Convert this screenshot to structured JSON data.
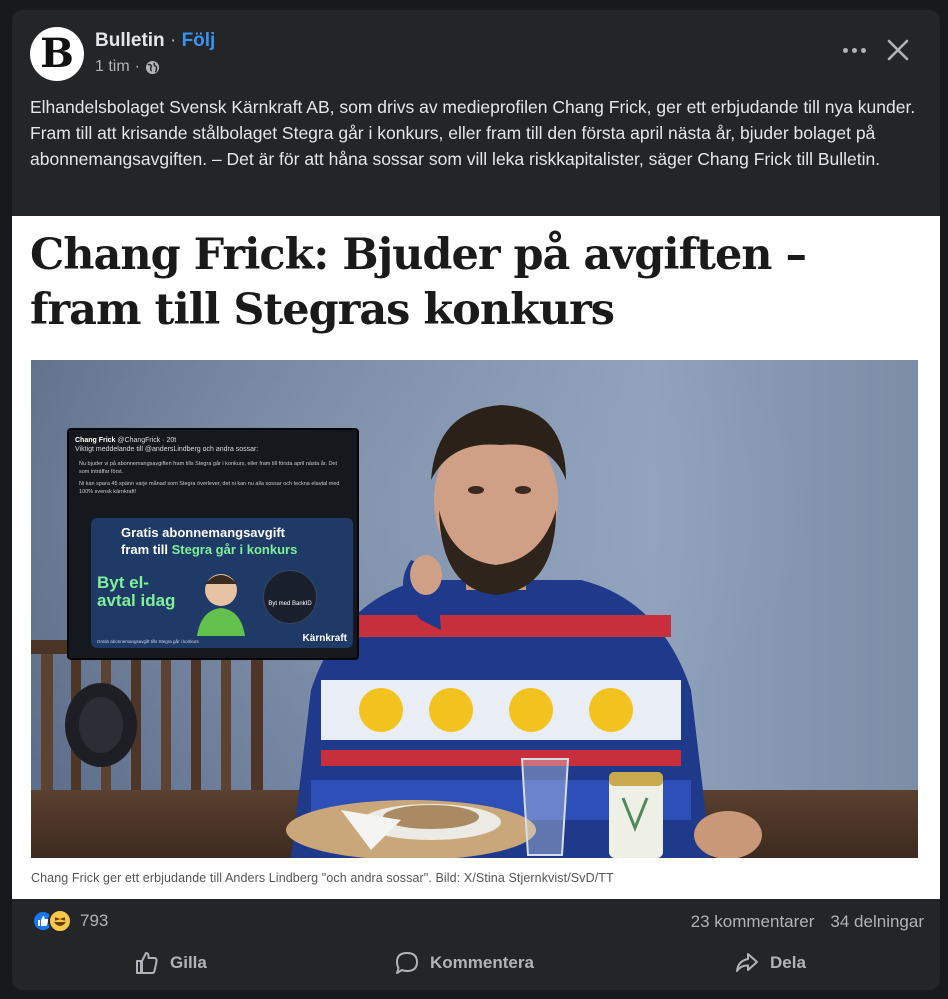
{
  "post": {
    "author": "Bulletin",
    "separator": "·",
    "follow_label": "Följ",
    "time": "1 tim",
    "time_separator": "·",
    "avatar_letter": "B",
    "text": "Elhandelsbolaget Svensk Kärnkraft AB, som drivs av medieprofilen Chang Frick, ger ett erbjudande till nya kunder. Fram till att krisande stålbolaget Stegra går i konkurs, eller fram till den första april nästa år, bjuder bolaget på abonnemangsavgiften. – Det är för att håna sossar som vill leka riskkapitalister, säger Chang Frick till Bulletin."
  },
  "article": {
    "headline": "Chang Frick: Bjuder på avgiften – fram till Stegras konkurs",
    "caption": "Chang Frick ger ett erbjudande till Anders Lindberg \"och andra sossar\". Bild: X/Stina Stjernkvist/SvD/TT"
  },
  "screen": {
    "name": "Chang Frick",
    "handle": "@ChangFrick · 20t",
    "line1": "Viktigt meddelande till @andersLindberg och andra sossar:",
    "line2": "Nu bjuder vi på abonnemangsavgiften fram tills Stegra går i konkurs, eller fram till första april nästa år. Det som inträffar först.",
    "line3": "Ni kan spara 45 spänn varje månad som Stegra överlever, det ni kan nu alla sossar och teckna elavtal med 100% svensk kärnkraft!",
    "ad_title_1": "Gratis abonnemangsavgift",
    "ad_title_2": "fram till",
    "ad_title_hl": "Stegra går i konkurs",
    "ad_big": "Byt el-avtal idag",
    "ad_bank": "Byt med BankID",
    "ad_brand": "Kärnkraft",
    "ad_foot": "Gratis abonnemangsavgift tills Stegra går i konkurs"
  },
  "reactions": {
    "count": "793",
    "comments": "23 kommentarer",
    "shares": "34 delningar"
  },
  "actions": {
    "like": "Gilla",
    "comment": "Kommentera",
    "share": "Dela"
  },
  "colors": {
    "card_bg": "#242526",
    "page_bg": "#18191a",
    "follow_blue": "#3a92f5",
    "like_blue": "#1877f2",
    "muted": "#b0b3b8"
  },
  "icons": [
    "globe-icon",
    "more-icon",
    "close-icon",
    "like-reaction-icon",
    "haha-reaction-icon",
    "like-icon",
    "comment-icon",
    "share-icon"
  ]
}
